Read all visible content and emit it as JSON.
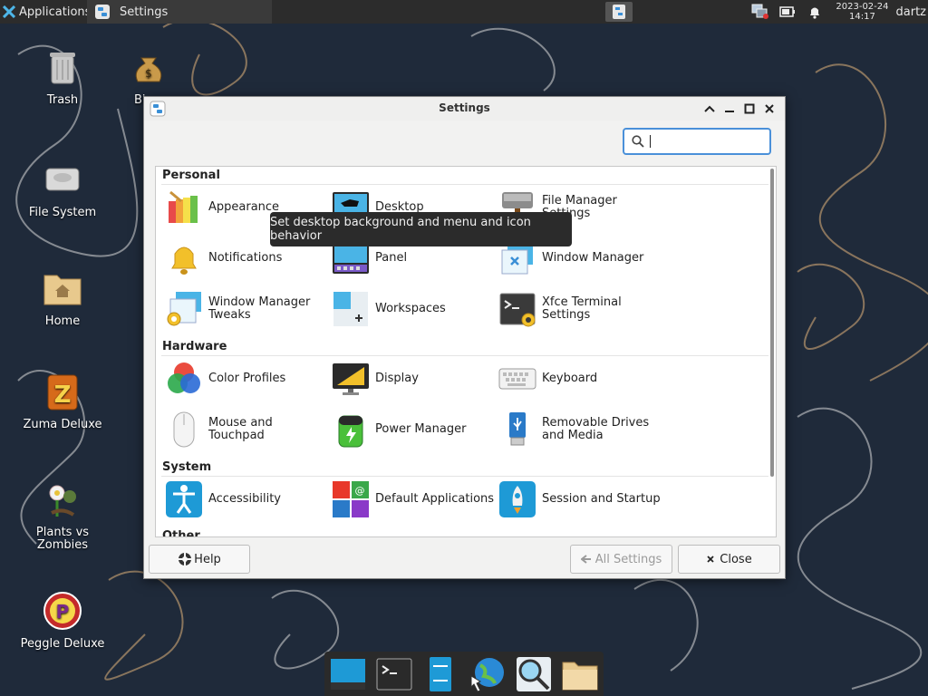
{
  "top_panel": {
    "applications_label": "Applications",
    "task_label": "Settings",
    "clock_date": "2023-02-24",
    "clock_time": "14:17",
    "user": "dartz"
  },
  "desktop_icons": [
    {
      "label": "Trash",
      "icon": "trash-icon"
    },
    {
      "label": "Bi",
      "icon": "money-bag-icon"
    },
    {
      "label": "File System",
      "icon": "drive-icon"
    },
    {
      "label": "Home",
      "icon": "home-folder-icon"
    },
    {
      "label": "Zuma Deluxe",
      "icon": "zuma-icon"
    },
    {
      "label": "Plants vs Zombies",
      "icon": "plants-icon"
    },
    {
      "label": "Peggle Deluxe",
      "icon": "peggle-icon"
    }
  ],
  "window": {
    "title": "Settings",
    "search_value": "",
    "categories": {
      "personal": "Personal",
      "hardware": "Hardware",
      "system": "System",
      "other": "Other"
    },
    "items": {
      "appearance": "Appearance",
      "desktop": "Desktop",
      "file_manager": "File Manager Settings",
      "notifications": "Notifications",
      "panel": "Panel",
      "window_manager": "Window Manager",
      "wm_tweaks": "Window Manager Tweaks",
      "workspaces": "Workspaces",
      "xfce_terminal": "Xfce Terminal Settings",
      "color_profiles": "Color Profiles",
      "display": "Display",
      "keyboard": "Keyboard",
      "mouse": "Mouse and Touchpad",
      "power_manager": "Power Manager",
      "removable_drives": "Removable Drives and Media",
      "accessibility": "Accessibility",
      "default_apps": "Default Applications",
      "session": "Session and Startup"
    },
    "buttons": {
      "help": "Help",
      "all_settings": "All Settings",
      "close": "Close"
    },
    "tooltip": "Set desktop background and menu and icon behavior"
  },
  "colors": {
    "accent": "#4a90d9",
    "panel_bg": "#2c2c2c",
    "wallpaper": "#1f2a3a"
  }
}
